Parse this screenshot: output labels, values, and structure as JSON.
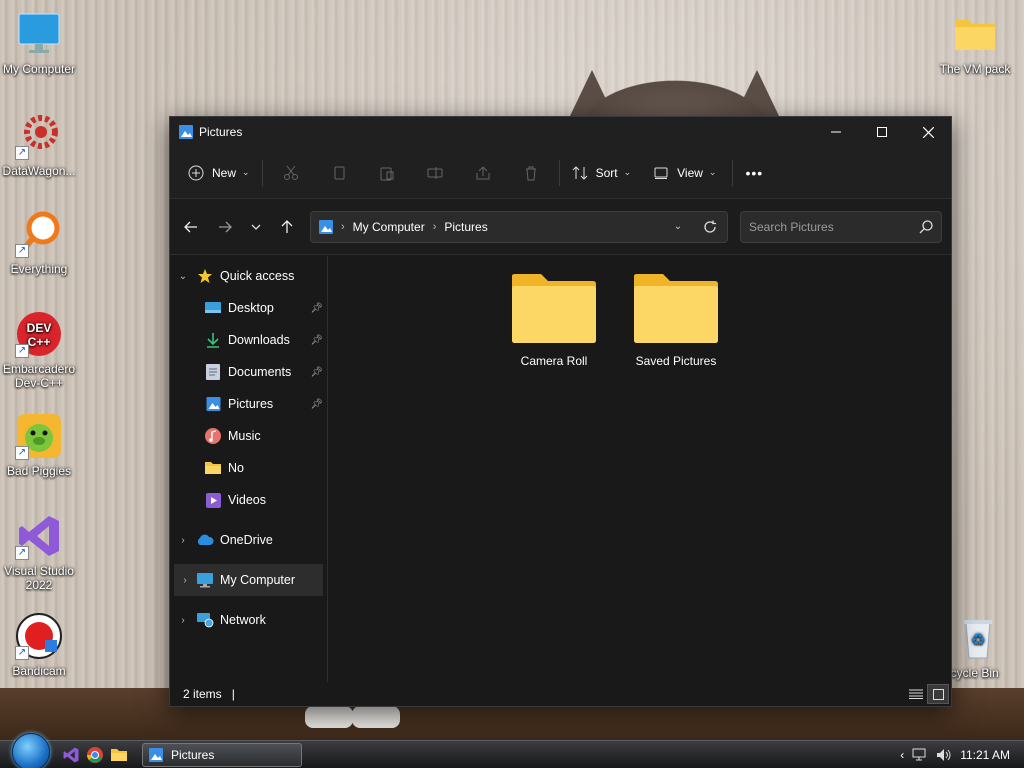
{
  "desktop": {
    "icons": [
      {
        "label": "My Computer"
      },
      {
        "label": "DataWagon..."
      },
      {
        "label": "Everything"
      },
      {
        "label": "Embarcadero Dev-C++"
      },
      {
        "label": "Bad Piggies"
      },
      {
        "label": "Visual Studio 2022"
      },
      {
        "label": "Bandicam"
      },
      {
        "label": "The VM pack"
      },
      {
        "label": "ecycle Bin"
      }
    ],
    "devcpp_logo_text": "DEV C++"
  },
  "window": {
    "title": "Pictures",
    "toolbar": {
      "new_label": "New",
      "sort_label": "Sort",
      "view_label": "View",
      "more_label": "•••"
    },
    "address": {
      "crumbs": [
        "My Computer",
        "Pictures"
      ]
    },
    "search": {
      "placeholder": "Search Pictures"
    },
    "nav": {
      "quick_access": "Quick access",
      "items": [
        {
          "label": "Desktop",
          "pinned": true
        },
        {
          "label": "Downloads",
          "pinned": true
        },
        {
          "label": "Documents",
          "pinned": true
        },
        {
          "label": "Pictures",
          "pinned": true
        },
        {
          "label": "Music"
        },
        {
          "label": "No"
        },
        {
          "label": "Videos"
        }
      ],
      "roots": [
        {
          "label": "OneDrive"
        },
        {
          "label": "My Computer"
        },
        {
          "label": "Network"
        }
      ]
    },
    "folders": [
      {
        "name": "Camera Roll"
      },
      {
        "name": "Saved Pictures"
      }
    ],
    "status": {
      "count": "2 items",
      "caret": "|"
    }
  },
  "taskbar": {
    "task_label": "Pictures",
    "clock": "11:21 AM"
  },
  "colors": {
    "folder": "#f8c93f",
    "accent": "#4aa8ff"
  }
}
